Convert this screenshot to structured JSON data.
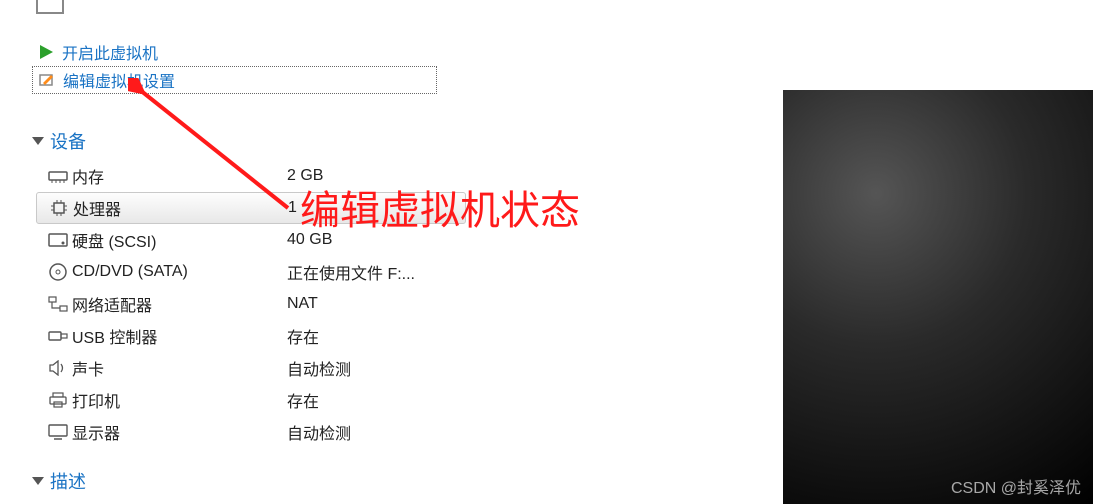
{
  "actions": {
    "power_on": "开启此虚拟机",
    "edit_settings": "编辑虚拟机设置"
  },
  "sections": {
    "devices": "设备",
    "description": "描述"
  },
  "devices": [
    {
      "icon": "memory-icon",
      "label": "内存",
      "value": "2 GB"
    },
    {
      "icon": "cpu-icon",
      "label": "处理器",
      "value": "1",
      "selected": true
    },
    {
      "icon": "disk-icon",
      "label": "硬盘 (SCSI)",
      "value": "40 GB"
    },
    {
      "icon": "cd-icon",
      "label": "CD/DVD (SATA)",
      "value": "正在使用文件 F:..."
    },
    {
      "icon": "network-icon",
      "label": "网络适配器",
      "value": "NAT"
    },
    {
      "icon": "usb-icon",
      "label": "USB 控制器",
      "value": "存在"
    },
    {
      "icon": "sound-icon",
      "label": "声卡",
      "value": "自动检测"
    },
    {
      "icon": "printer-icon",
      "label": "打印机",
      "value": "存在"
    },
    {
      "icon": "display-icon",
      "label": "显示器",
      "value": "自动检测"
    }
  ],
  "annotation": "编辑虚拟机状态",
  "watermark": "CSDN @封奚泽优",
  "colors": {
    "link": "#1a73c4",
    "annotation": "#ff1a1a"
  }
}
